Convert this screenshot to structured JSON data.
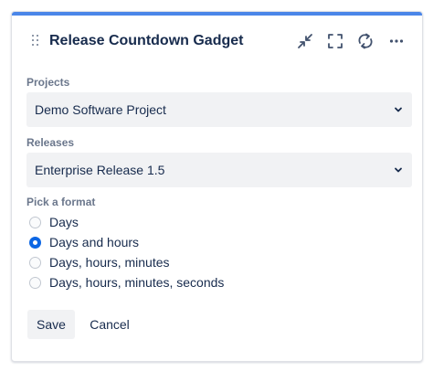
{
  "gadget": {
    "title": "Release Countdown Gadget",
    "accent_color": "#4a86e8",
    "header_icons": [
      "minimize-icon",
      "fullscreen-icon",
      "refresh-icon",
      "more-icon"
    ]
  },
  "projects": {
    "label": "Projects",
    "selected": "Demo Software Project"
  },
  "releases": {
    "label": "Releases",
    "selected": "Enterprise Release 1.5"
  },
  "format": {
    "label": "Pick a format",
    "options": [
      {
        "label": "Days",
        "checked": false
      },
      {
        "label": "Days and hours",
        "checked": true
      },
      {
        "label": "Days, hours, minutes",
        "checked": false
      },
      {
        "label": "Days, hours, minutes, seconds",
        "checked": false
      }
    ]
  },
  "actions": {
    "save_label": "Save",
    "cancel_label": "Cancel"
  }
}
